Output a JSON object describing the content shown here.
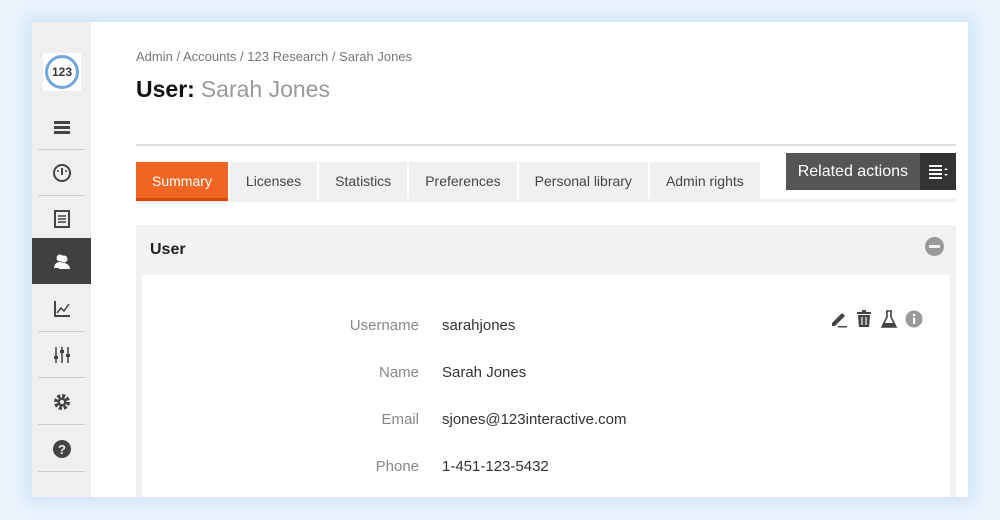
{
  "app": {
    "logo_text": "123"
  },
  "sidebar": {
    "items": [
      {
        "name": "menu",
        "icon": "hamburger-icon"
      },
      {
        "name": "dashboard",
        "icon": "gauge-icon"
      },
      {
        "name": "documents",
        "icon": "document-icon"
      },
      {
        "name": "users",
        "icon": "users-icon",
        "active": true
      },
      {
        "name": "reports",
        "icon": "chart-icon"
      },
      {
        "name": "adjustments",
        "icon": "sliders-icon"
      },
      {
        "name": "settings",
        "icon": "gear-icon"
      },
      {
        "name": "help",
        "icon": "help-icon"
      }
    ]
  },
  "breadcrumb": "Admin / Accounts / 123 Research / Sarah Jones",
  "header": {
    "label": "User:",
    "name": "Sarah Jones"
  },
  "tabs": [
    {
      "label": "Summary",
      "active": true
    },
    {
      "label": "Licenses"
    },
    {
      "label": "Statistics"
    },
    {
      "label": "Preferences"
    },
    {
      "label": "Personal library"
    },
    {
      "label": "Admin rights"
    }
  ],
  "related_actions": {
    "label": "Related actions"
  },
  "panel": {
    "title": "User",
    "fields": [
      {
        "label": "Username",
        "value": "sarahjones"
      },
      {
        "label": "Name",
        "value": "Sarah Jones"
      },
      {
        "label": "Email",
        "value": "sjones@123interactive.com"
      },
      {
        "label": "Phone",
        "value": "1-451-123-5432"
      }
    ]
  },
  "colors": {
    "accent": "#f26522",
    "sidebar_active": "#404040"
  }
}
